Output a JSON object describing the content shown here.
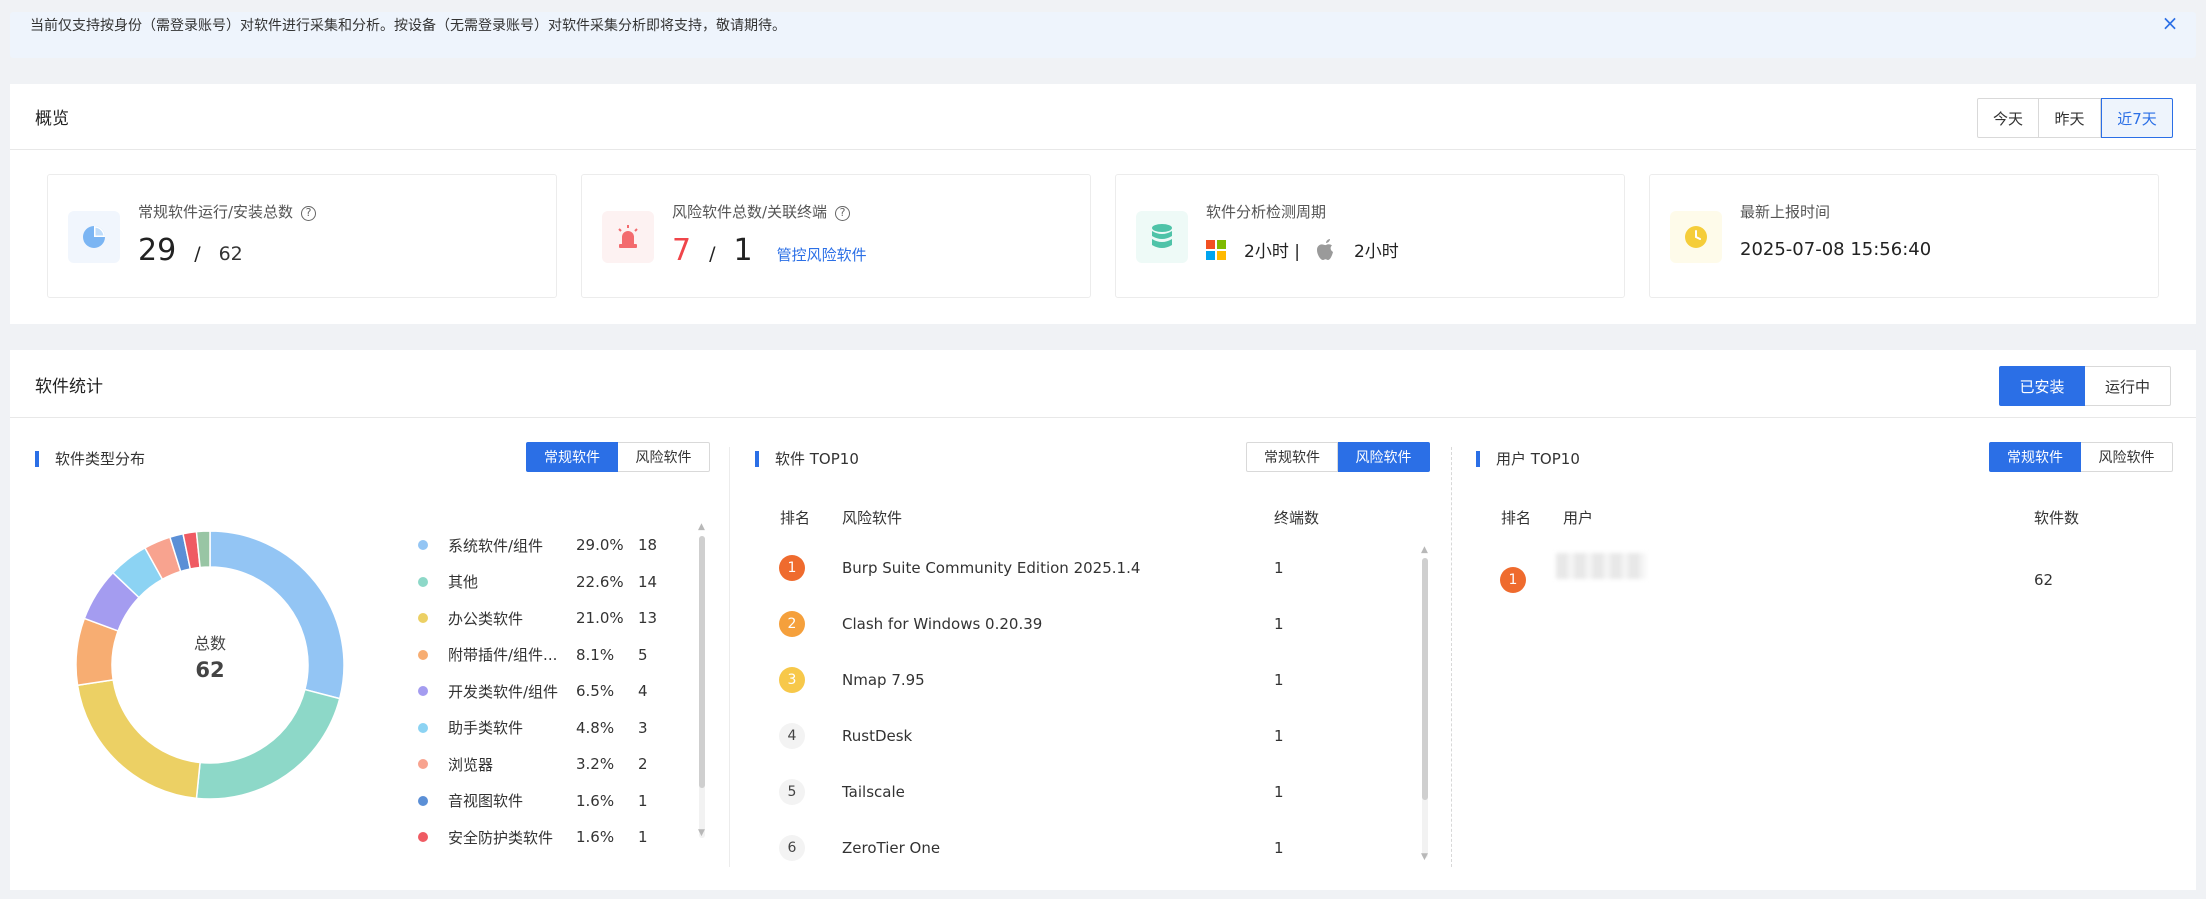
{
  "notice": {
    "text": "当前仅支持按身份（需登录账号）对软件进行采集和分析。按设备（无需登录账号）对软件采集分析即将支持，敬请期待。",
    "close_icon": "close-icon",
    "close": "×"
  },
  "overview": {
    "title": "概览",
    "ranges": [
      "今天",
      "昨天",
      "近7天"
    ],
    "selected_range": 2,
    "cards": {
      "normal": {
        "label": "常规软件运行/安装总数",
        "running": "29",
        "sep": "/",
        "installed": "62",
        "help": "?"
      },
      "risk": {
        "label": "风险软件总数/关联终端",
        "total": "7",
        "sep": "/",
        "terminals": "1",
        "link": "管控风险软件",
        "help": "?"
      },
      "period": {
        "label": "软件分析检测周期",
        "windows": "2小时 |",
        "mac": "2小时"
      },
      "latest": {
        "label": "最新上报时间",
        "time": "2025-07-08 15:56:40"
      }
    }
  },
  "stats": {
    "title": "软件统计",
    "modes": [
      "已安装",
      "运行中"
    ],
    "selected_mode": 0,
    "type_dist": {
      "title": "软件类型分布",
      "tabs": [
        "常规软件",
        "风险软件"
      ],
      "selected_tab": 0,
      "center_label": "总数",
      "center_value": "62"
    },
    "top10": {
      "title": "软件 TOP10",
      "tabs": [
        "常规软件",
        "风险软件"
      ],
      "selected_tab": 1,
      "headers": [
        "排名",
        "风险软件",
        "终端数"
      ],
      "rows": [
        {
          "rank": "1",
          "name": "Burp Suite Community Edition 2025.1.4",
          "count": "1"
        },
        {
          "rank": "2",
          "name": "Clash for Windows 0.20.39",
          "count": "1"
        },
        {
          "rank": "3",
          "name": "Nmap 7.95",
          "count": "1"
        },
        {
          "rank": "4",
          "name": "RustDesk",
          "count": "1"
        },
        {
          "rank": "5",
          "name": "Tailscale",
          "count": "1"
        },
        {
          "rank": "6",
          "name": "ZeroTier One",
          "count": "1"
        }
      ]
    },
    "user_top10": {
      "title": "用户 TOP10",
      "tabs": [
        "常规软件",
        "风险软件"
      ],
      "selected_tab": 0,
      "headers": [
        "排名",
        "用户",
        "软件数"
      ],
      "rows": [
        {
          "rank": "1",
          "count": "62"
        }
      ]
    }
  },
  "colors": {
    "accent": "#2b6fe6",
    "rank1": "#ef6b2e",
    "rank2": "#f5a03c",
    "rank3": "#f7c84a"
  },
  "chart_data": {
    "type": "pie",
    "categories": [
      "系统软件/组件",
      "其他",
      "办公类软件",
      "附带插件/组件...",
      "开发类软件/组件",
      "助手类软件",
      "浏览器",
      "音视图软件",
      "安全防护类软件"
    ],
    "values": [
      18,
      14,
      13,
      5,
      4,
      3,
      2,
      1,
      1
    ],
    "percents": [
      "29.0%",
      "22.6%",
      "21.0%",
      "8.1%",
      "6.5%",
      "4.8%",
      "3.2%",
      "1.6%",
      "1.6%"
    ],
    "extra_segments": [
      1
    ],
    "colors": [
      "#93c5f4",
      "#8dd8c8",
      "#ecd064",
      "#f7ad72",
      "#a49cf0",
      "#8cd3f3",
      "#f8a38f",
      "#5b8fd6",
      "#ef5b63",
      "#98c5a4"
    ],
    "legend": "right"
  }
}
